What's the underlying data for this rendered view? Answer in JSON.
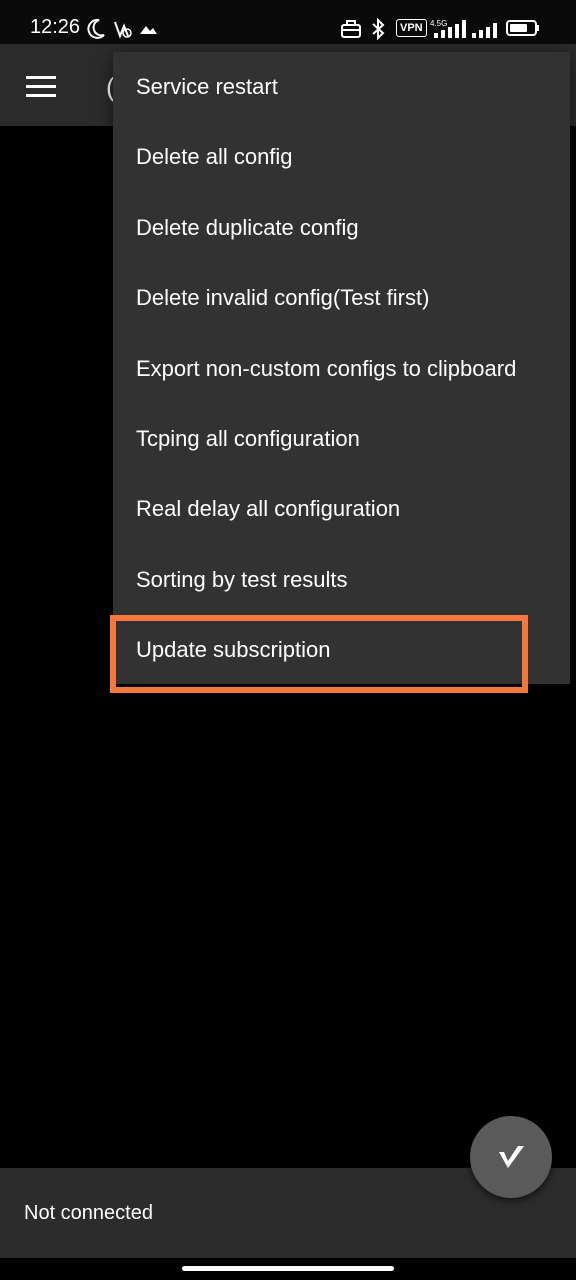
{
  "status_bar": {
    "time": "12:26",
    "vpn_label": "VPN",
    "network_type": "4.5G",
    "icons": [
      "moon-icon",
      "wifi-off-icon",
      "data-arrow-icon",
      "briefcase-icon",
      "bluetooth-icon",
      "vpn-icon",
      "signal-icon",
      "signal-icon",
      "battery-icon"
    ]
  },
  "app_bar": {
    "title_partial": "("
  },
  "overflow_menu": {
    "items": [
      {
        "label": "Service restart"
      },
      {
        "label": "Delete all config"
      },
      {
        "label": "Delete duplicate config"
      },
      {
        "label": "Delete invalid config(Test first)"
      },
      {
        "label": "Export non-custom configs to clipboard"
      },
      {
        "label": "Tcping all configuration"
      },
      {
        "label": "Real delay all configuration"
      },
      {
        "label": "Sorting by test results"
      },
      {
        "label": "Update subscription"
      }
    ],
    "highlighted_item": "Update subscription",
    "highlight_color": "#f4773f"
  },
  "bottom_bar": {
    "status_text": "Not connected"
  },
  "fab": {
    "icon": "v-logo-icon"
  },
  "colors": {
    "app_bar": "#2b2b2b",
    "menu_bg": "#323232",
    "fab_bg": "#5a5a5a",
    "background": "#000000"
  }
}
